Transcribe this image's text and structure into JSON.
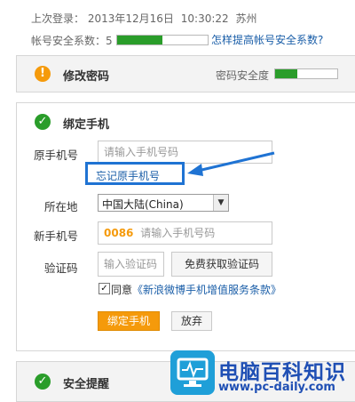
{
  "header": {
    "last_login_label": "上次登录：",
    "last_login_date": "2013年12月16日",
    "last_login_time": "10:30:22",
    "last_login_city": "苏州",
    "security_label": "帐号安全系数：",
    "security_value": "5",
    "security_fill_fraction": 0.5,
    "improve_link": "怎样提高帐号安全系数?"
  },
  "change_password": {
    "title": "修改密码",
    "strength_label": "密码安全度",
    "strength_fill_fraction": 0.35
  },
  "bind_phone": {
    "title": "绑定手机",
    "old_phone_label": "原手机号",
    "old_phone_placeholder": "请输入手机号码",
    "forgot_link": "忘记原手机号",
    "location_label": "所在地",
    "location_value": "中国大陆(China)",
    "new_phone_label": "新手机号",
    "new_phone_prefix": "0086",
    "new_phone_placeholder": "请输入手机号码",
    "code_label": "验证码",
    "code_placeholder": "输入验证码",
    "get_code_button": "免费获取验证码",
    "agree_prefix": "同意",
    "agree_terms": "《新浪微博手机增值服务条款》",
    "bind_button": "绑定手机",
    "cancel_button": "放弃"
  },
  "security_alert": {
    "title": "安全提醒"
  },
  "watermark": {
    "brand": "电脑百科知识",
    "url": "www.pc-daily.com"
  },
  "colors": {
    "accent_orange": "#f59a0b",
    "success_green": "#2a9d2a",
    "link_blue": "#1a5ea8",
    "highlight_blue": "#1f73d3"
  }
}
